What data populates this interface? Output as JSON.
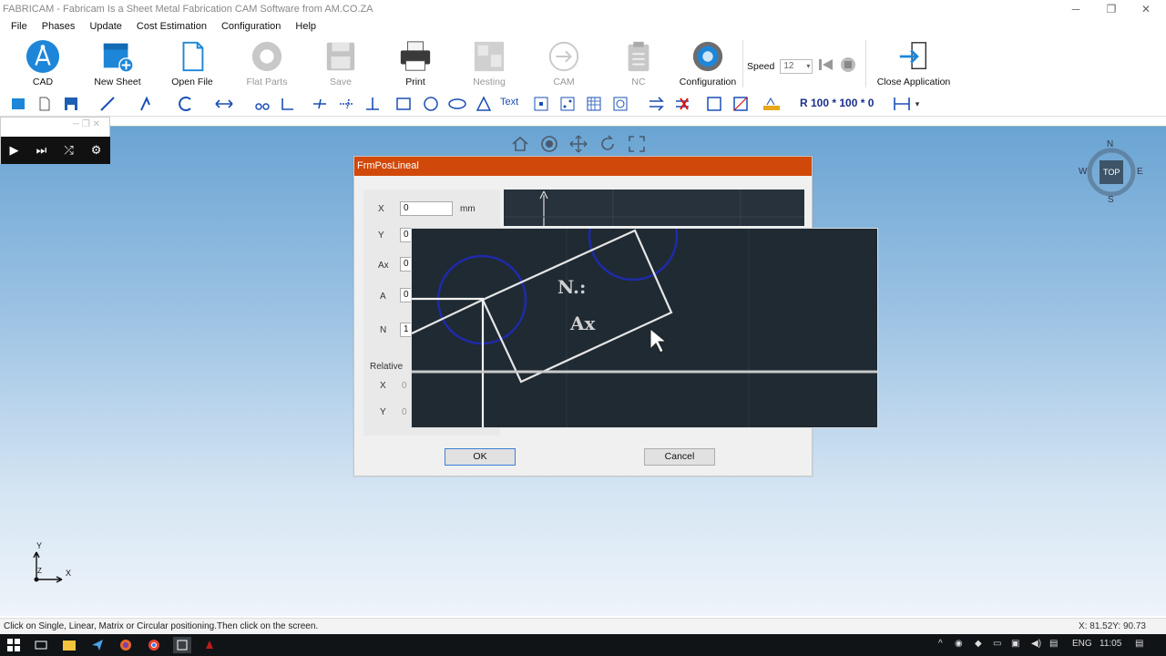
{
  "window": {
    "title": "FABRICAM - Fabricam Is a Sheet Metal Fabrication CAM Software from AM.CO.ZA",
    "minimize": "─",
    "restore": "❐",
    "close": "✕"
  },
  "menu": [
    "File",
    "Phases",
    "Update",
    "Cost Estimation",
    "Configuration",
    "Help"
  ],
  "ribbon": {
    "cad": "CAD",
    "new_sheet": "New Sheet",
    "open_file": "Open File",
    "flat_parts": "Flat Parts",
    "save": "Save",
    "print": "Print",
    "nesting": "Nesting",
    "cam": "CAM",
    "nc": "NC",
    "configuration": "Configuration",
    "speed_label": "Speed",
    "speed_value": "12",
    "close_application": "Close Application"
  },
  "toolbar": {
    "text_tool": "Text",
    "coordinate_readout": "R 100 * 100 * 0"
  },
  "compass": {
    "top": "TOP",
    "n": "N",
    "s": "S",
    "e": "E",
    "w": "W"
  },
  "axes": {
    "x": "X",
    "y": "Y",
    "z": "Z"
  },
  "dialog": {
    "title": "FrmPosLineal",
    "fields": {
      "x_label": "X",
      "x_value": "0",
      "x_unit": "mm",
      "y_label": "Y",
      "y_value": "0",
      "ax_label": "Ax",
      "ax_value": "0",
      "a_label": "A",
      "a_value": "0",
      "n_label": "N",
      "n_value": "1"
    },
    "relative": {
      "label": "Relative",
      "x_label": "X",
      "x_value": "0",
      "y_label": "Y",
      "y_value": "0"
    },
    "ok": "OK",
    "cancel": "Cancel"
  },
  "zoom_overlay": {
    "n_label": "N.:",
    "ax_label": "Ax"
  },
  "status": {
    "message": "Click on Single, Linear, Matrix or Circular positioning.Then click on the screen.",
    "coords": "X: 81.52Y: 90.73"
  },
  "taskbar": {
    "language": "ENG",
    "time": "11:05"
  }
}
